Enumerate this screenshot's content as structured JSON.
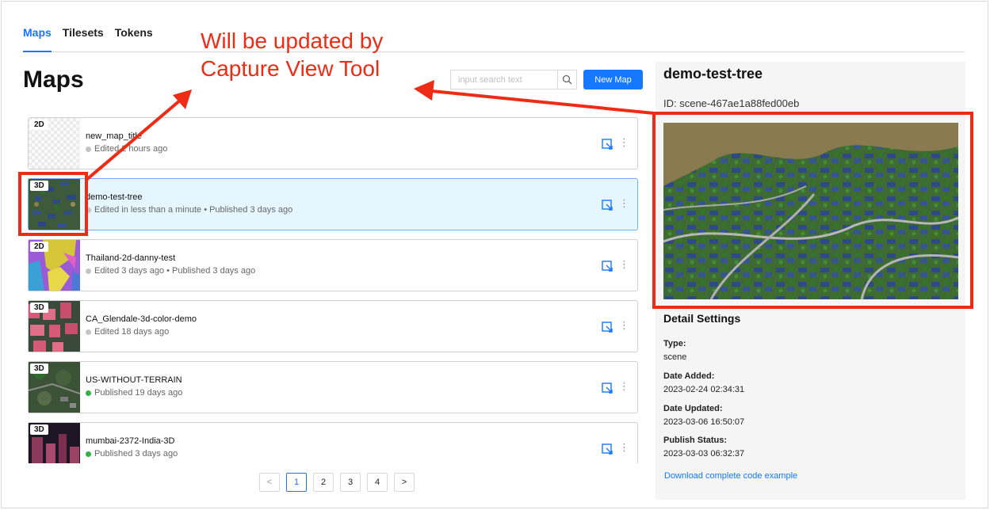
{
  "tabs": [
    {
      "label": "Maps",
      "active": true
    },
    {
      "label": "Tilesets",
      "active": false
    },
    {
      "label": "Tokens",
      "active": false
    }
  ],
  "page_title": "Maps",
  "search": {
    "placeholder": "input search text",
    "icon": "search-icon"
  },
  "new_map_label": "New Map",
  "maps": [
    {
      "badge": "2D",
      "name": "new_map_title",
      "status": "Edited 2 hours ago",
      "status_color": "grey",
      "selected": false
    },
    {
      "badge": "3D",
      "name": "demo-test-tree",
      "status": "Edited in less than a minute • Published 3 days ago",
      "status_color": "grey",
      "selected": true
    },
    {
      "badge": "2D",
      "name": "Thailand-2d-danny-test",
      "status": "Edited 3 days ago • Published 3 days ago",
      "status_color": "grey",
      "selected": false
    },
    {
      "badge": "3D",
      "name": "CA_Glendale-3d-color-demo",
      "status": "Edited 18 days ago",
      "status_color": "grey",
      "selected": false
    },
    {
      "badge": "3D",
      "name": "US-WITHOUT-TERRAIN",
      "status": "Published 19 days ago",
      "status_color": "green",
      "selected": false
    },
    {
      "badge": "3D",
      "name": "mumbai-2372-India-3D",
      "status": "Published 3 days ago",
      "status_color": "green",
      "selected": false
    }
  ],
  "pagination": {
    "prev": "<",
    "pages": [
      "1",
      "2",
      "3",
      "4"
    ],
    "current": "1",
    "next": ">"
  },
  "detail": {
    "title": "demo-test-tree",
    "id_text": "ID: scene-467ae1a88fed00eb",
    "settings_heading": "Detail Settings",
    "fields": [
      {
        "label": "Type:",
        "value": "scene"
      },
      {
        "label": "Date Added:",
        "value": "2023-02-24 02:34:31"
      },
      {
        "label": "Date Updated:",
        "value": "2023-03-06 16:50:07"
      },
      {
        "label": "Publish Status:",
        "value": "2023-03-03 06:32:37"
      }
    ],
    "download_link": "Download complete code example"
  },
  "annotation": {
    "line1": "Will be updated by",
    "line2": "Capture View Tool",
    "color": "#ee2b14"
  },
  "colors": {
    "accent": "#1677ff",
    "selected_bg": "#e6f6ff",
    "published": "#2fb344"
  }
}
